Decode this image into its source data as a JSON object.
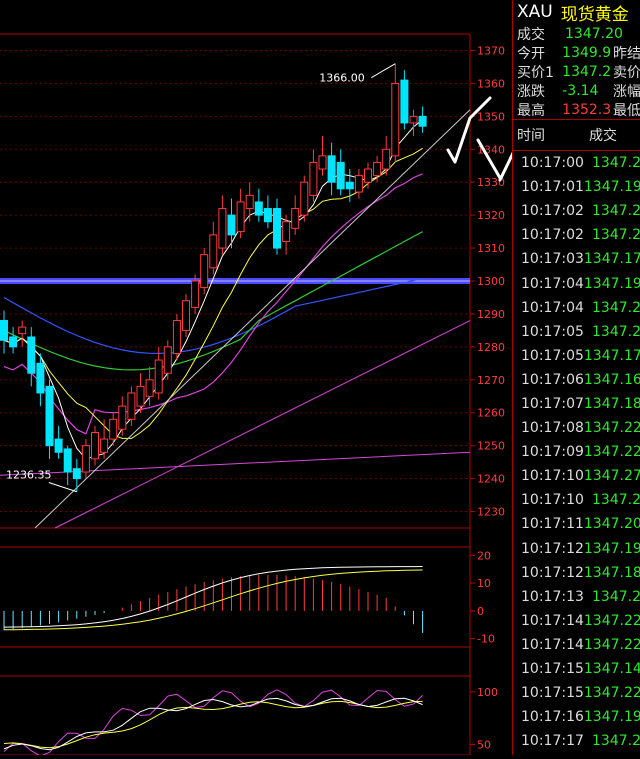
{
  "quote_panel": {
    "symbol": "XAU",
    "name": "现货黄金",
    "rows": [
      {
        "label": "成交",
        "value": "1347.20",
        "value_color": "#2ee82e",
        "extra": ""
      },
      {
        "label": "今开",
        "value": "1349.9",
        "value_color": "#2ee82e",
        "extra": "昨结"
      },
      {
        "label": "买价1",
        "value": "1347.2",
        "value_color": "#2ee82e",
        "extra": "卖价"
      },
      {
        "label": "涨跌",
        "value": "-3.14",
        "value_color": "#2ee82e",
        "extra": "涨幅"
      },
      {
        "label": "最高",
        "value": "1352.3",
        "value_color": "#ff3b3b",
        "extra": "最低"
      }
    ],
    "tick_header": {
      "time": "时间",
      "price": "成交"
    },
    "ticks": [
      {
        "time": "10:17:00",
        "price": "1347.2"
      },
      {
        "time": "10:17:01",
        "price": "1347.19"
      },
      {
        "time": "10:17:02",
        "price": "1347.2"
      },
      {
        "time": "10:17:02",
        "price": "1347.2"
      },
      {
        "time": "10:17:03",
        "price": "1347.17"
      },
      {
        "time": "10:17:04",
        "price": "1347.19"
      },
      {
        "time": "10:17:04",
        "price": "1347.2"
      },
      {
        "time": "10:17:05",
        "price": "1347.2"
      },
      {
        "time": "10:17:05",
        "price": "1347.17"
      },
      {
        "time": "10:17:06",
        "price": "1347.16"
      },
      {
        "time": "10:17:07",
        "price": "1347.18"
      },
      {
        "time": "10:17:08",
        "price": "1347.22"
      },
      {
        "time": "10:17:09",
        "price": "1347.22"
      },
      {
        "time": "10:17:10",
        "price": "1347.27"
      },
      {
        "time": "10:17:10",
        "price": "1347.2"
      },
      {
        "time": "10:17:11",
        "price": "1347.20"
      },
      {
        "time": "10:17:12",
        "price": "1347.19"
      },
      {
        "time": "10:17:12",
        "price": "1347.18"
      },
      {
        "time": "10:17:13",
        "price": "1347.2"
      },
      {
        "time": "10:17:14",
        "price": "1347.22"
      },
      {
        "time": "10:17:14",
        "price": "1347.22"
      },
      {
        "time": "10:17:15",
        "price": "1347.14"
      },
      {
        "time": "10:17:15",
        "price": "1347.22"
      },
      {
        "time": "10:17:16",
        "price": "1347.19"
      },
      {
        "time": "10:17:17",
        "price": "1347.2"
      }
    ]
  },
  "chart_data": [
    {
      "type": "candlestick",
      "price_ticks": [
        "1370",
        "1360",
        "1350",
        "1340",
        "1330",
        "1320",
        "1310",
        "1300",
        "1290",
        "1280",
        "1270",
        "1260",
        "1250",
        "1240",
        "1230"
      ],
      "ylim": [
        1225,
        1375
      ],
      "annotations": {
        "high": "1366.00",
        "low": "1236.35"
      },
      "horizontal_level": 1300,
      "colors": {
        "up": "#ff3b3b",
        "down": "#00e5ff",
        "ma5": "#ffffff",
        "ma10": "#ffff44",
        "ma20": "#dd44dd",
        "ma60": "#33cc33",
        "ma120": "#3355ff",
        "trend": "#dd44dd",
        "level": "#4a4aff"
      },
      "candles": [
        {
          "o": 1288,
          "h": 1291,
          "l": 1278,
          "c": 1282
        },
        {
          "o": 1283,
          "h": 1286,
          "l": 1278,
          "c": 1280
        },
        {
          "o": 1284,
          "h": 1288,
          "l": 1280,
          "c": 1286
        },
        {
          "o": 1283,
          "h": 1286,
          "l": 1268,
          "c": 1272
        },
        {
          "o": 1275,
          "h": 1278,
          "l": 1262,
          "c": 1266
        },
        {
          "o": 1268,
          "h": 1270,
          "l": 1246,
          "c": 1250
        },
        {
          "o": 1252,
          "h": 1256,
          "l": 1246,
          "c": 1248
        },
        {
          "o": 1249,
          "h": 1250,
          "l": 1238,
          "c": 1242
        },
        {
          "o": 1243,
          "h": 1246,
          "l": 1236,
          "c": 1240
        },
        {
          "o": 1242,
          "h": 1252,
          "l": 1240,
          "c": 1250
        },
        {
          "o": 1246,
          "h": 1256,
          "l": 1244,
          "c": 1254
        },
        {
          "o": 1248,
          "h": 1258,
          "l": 1246,
          "c": 1252
        },
        {
          "o": 1252,
          "h": 1260,
          "l": 1250,
          "c": 1258
        },
        {
          "o": 1255,
          "h": 1265,
          "l": 1253,
          "c": 1262
        },
        {
          "o": 1258,
          "h": 1268,
          "l": 1256,
          "c": 1266
        },
        {
          "o": 1262,
          "h": 1272,
          "l": 1260,
          "c": 1268
        },
        {
          "o": 1265,
          "h": 1274,
          "l": 1262,
          "c": 1270
        },
        {
          "o": 1266,
          "h": 1280,
          "l": 1264,
          "c": 1276
        },
        {
          "o": 1272,
          "h": 1282,
          "l": 1270,
          "c": 1280
        },
        {
          "o": 1278,
          "h": 1290,
          "l": 1276,
          "c": 1288
        },
        {
          "o": 1285,
          "h": 1296,
          "l": 1283,
          "c": 1294
        },
        {
          "o": 1292,
          "h": 1302,
          "l": 1290,
          "c": 1300
        },
        {
          "o": 1298,
          "h": 1310,
          "l": 1296,
          "c": 1308
        },
        {
          "o": 1304,
          "h": 1318,
          "l": 1302,
          "c": 1314
        },
        {
          "o": 1310,
          "h": 1326,
          "l": 1308,
          "c": 1322
        },
        {
          "o": 1320,
          "h": 1325,
          "l": 1310,
          "c": 1314
        },
        {
          "o": 1315,
          "h": 1328,
          "l": 1313,
          "c": 1324
        },
        {
          "o": 1322,
          "h": 1330,
          "l": 1318,
          "c": 1326
        },
        {
          "o": 1324,
          "h": 1328,
          "l": 1318,
          "c": 1320
        },
        {
          "o": 1322,
          "h": 1326,
          "l": 1316,
          "c": 1318
        },
        {
          "o": 1322,
          "h": 1325,
          "l": 1308,
          "c": 1310
        },
        {
          "o": 1312,
          "h": 1320,
          "l": 1308,
          "c": 1318
        },
        {
          "o": 1316,
          "h": 1326,
          "l": 1314,
          "c": 1322
        },
        {
          "o": 1320,
          "h": 1332,
          "l": 1318,
          "c": 1330
        },
        {
          "o": 1326,
          "h": 1340,
          "l": 1324,
          "c": 1336
        },
        {
          "o": 1334,
          "h": 1344,
          "l": 1332,
          "c": 1338
        },
        {
          "o": 1338,
          "h": 1342,
          "l": 1326,
          "c": 1330
        },
        {
          "o": 1336,
          "h": 1340,
          "l": 1326,
          "c": 1328
        },
        {
          "o": 1330,
          "h": 1334,
          "l": 1324,
          "c": 1328
        },
        {
          "o": 1327,
          "h": 1334,
          "l": 1325,
          "c": 1332
        },
        {
          "o": 1330,
          "h": 1336,
          "l": 1328,
          "c": 1334
        },
        {
          "o": 1332,
          "h": 1338,
          "l": 1330,
          "c": 1336
        },
        {
          "o": 1334,
          "h": 1344,
          "l": 1332,
          "c": 1340
        },
        {
          "o": 1338,
          "h": 1366,
          "l": 1336,
          "c": 1360
        },
        {
          "o": 1361,
          "h": 1364,
          "l": 1346,
          "c": 1348
        },
        {
          "o": 1348,
          "h": 1352,
          "l": 1344,
          "c": 1350
        },
        {
          "o": 1350,
          "h": 1353,
          "l": 1345,
          "c": 1347
        }
      ]
    },
    {
      "type": "bar",
      "ticks": [
        "20",
        "10",
        "0",
        "-10"
      ],
      "ylim": [
        -13,
        23
      ]
    },
    {
      "type": "line",
      "ticks": [
        "100",
        "50"
      ],
      "ylim": [
        40,
        115
      ]
    }
  ]
}
